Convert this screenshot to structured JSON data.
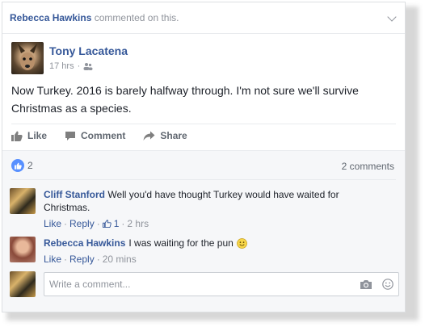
{
  "header": {
    "commenter": "Rebecca Hawkins",
    "suffix": "commented on this."
  },
  "post": {
    "author": "Tony Lacatena",
    "time": "17 hrs",
    "dot": "·",
    "text": "Now Turkey. 2016 is barely halfway through. I'm not sure we'll survive Christmas as a species."
  },
  "actions": {
    "like": "Like",
    "comment": "Comment",
    "share": "Share"
  },
  "stats": {
    "reactions": "2",
    "comments": "2 comments"
  },
  "comments": [
    {
      "name": "Cliff Stanford",
      "text": "Well you'd have thought Turkey would have waited for Christmas.",
      "like": "Like",
      "reply": "Reply",
      "dot": "·",
      "likes": "1",
      "time": "2 hrs"
    },
    {
      "name": "Rebecca Hawkins",
      "text": "I was waiting for the pun",
      "like": "Like",
      "reply": "Reply",
      "dot": "·",
      "time": "20 mins"
    }
  ],
  "composer": {
    "placeholder": "Write a comment..."
  },
  "icons": {
    "options": "chevron-down-icon",
    "audience": "friends-icon",
    "like": "thumbs-up-icon",
    "comment": "speech-bubble-icon",
    "share": "share-arrow-icon",
    "camera": "camera-icon",
    "emoji": "smiley-icon"
  },
  "colors": {
    "link": "#365899",
    "muted": "#90949c",
    "like_badge": "#5890ff",
    "panel": "#f6f7f9"
  }
}
